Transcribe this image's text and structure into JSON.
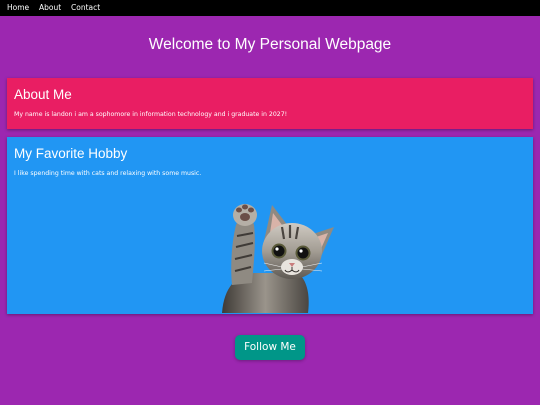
{
  "nav": {
    "items": [
      {
        "label": "Home"
      },
      {
        "label": "About"
      },
      {
        "label": "Contact"
      }
    ]
  },
  "header": {
    "title": "Welcome to My Personal Webpage"
  },
  "about": {
    "heading": "About Me",
    "text": "My name is landon i am a sophomore in information technology and i graduate in 2027!"
  },
  "hobby": {
    "heading": "My Favorite Hobby",
    "text": "I like spending time with cats and relaxing with some music.",
    "image": "cat-waving-photo"
  },
  "actions": {
    "follow_label": "Follow Me"
  },
  "colors": {
    "page_background": "#9c27b0",
    "nav_background": "#000000",
    "about_card": "#e91e63",
    "hobby_card": "#2196f3",
    "follow_button": "#009688"
  }
}
